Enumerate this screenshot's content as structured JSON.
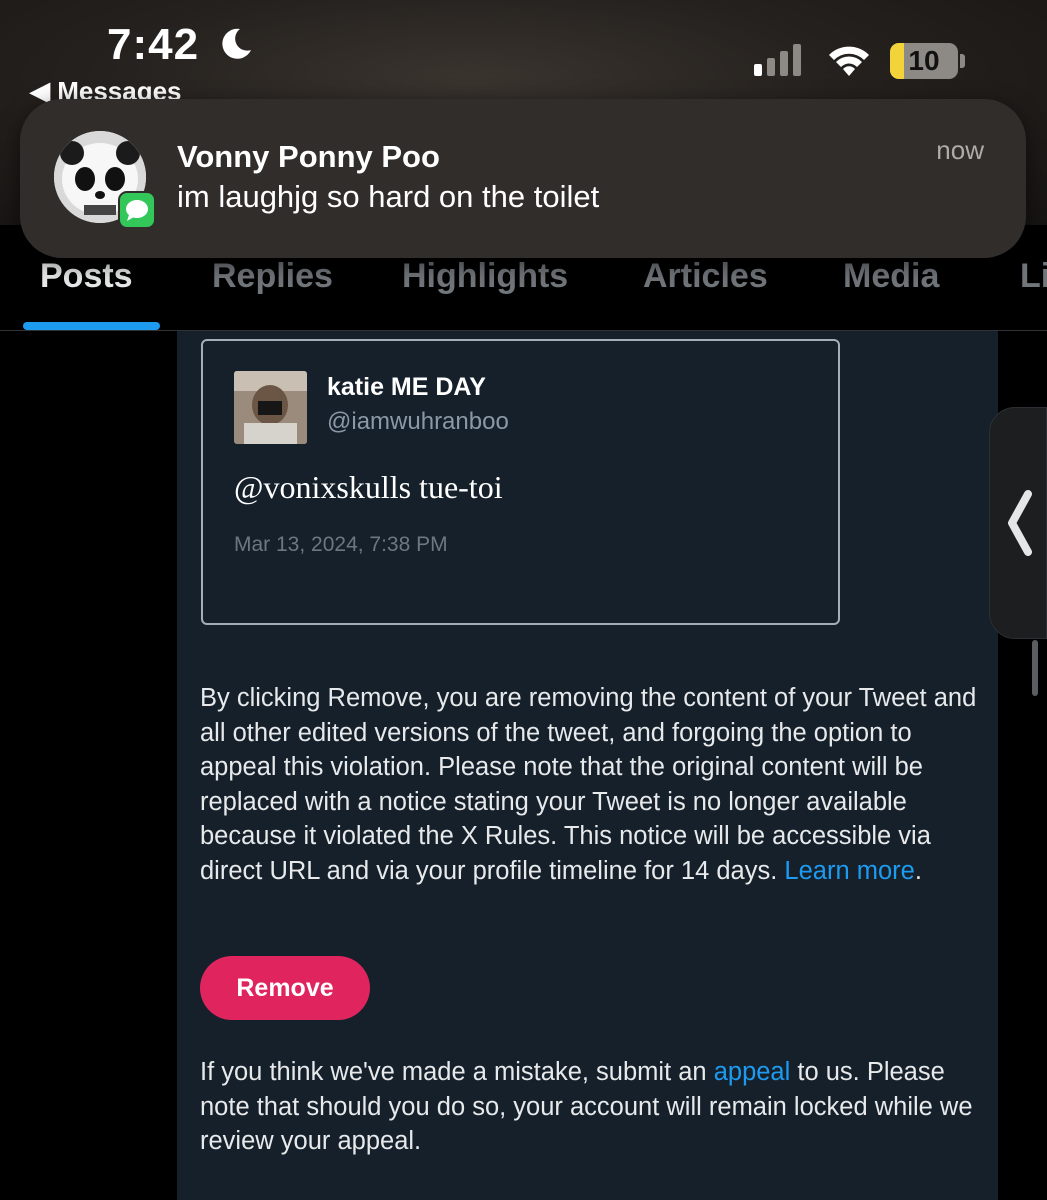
{
  "status_bar": {
    "time": "7:42",
    "back_label": "◀ Messages",
    "battery_level": "10",
    "focus_mode_icon": "moon-icon",
    "signal_bars_active": 1
  },
  "notification": {
    "sender": "Vonny Ponny Poo",
    "message": "im laughjg so hard on the toilet",
    "time": "now",
    "app_icon": "messages-icon"
  },
  "tabs": [
    {
      "label": "Posts",
      "active": true
    },
    {
      "label": "Replies",
      "active": false
    },
    {
      "label": "Highlights",
      "active": false
    },
    {
      "label": "Articles",
      "active": false
    },
    {
      "label": "Media",
      "active": false
    },
    {
      "label": "Li",
      "active": false
    }
  ],
  "quoted_tweet": {
    "display_name": "katie ME DAY",
    "handle": "@iamwuhranboo",
    "text": "@vonixskulls tue-toi",
    "timestamp": "Mar 13, 2024, 7:38 PM"
  },
  "notice": {
    "body": "By clicking Remove, you are removing the content of your Tweet and all other edited versions of the tweet, and forgoing the option to appeal this violation. Please note that the original content will be replaced with a notice stating your Tweet is no longer available because it violated the X Rules. This notice will be accessible via direct URL and via your profile timeline for 14 days.",
    "learn_more": "Learn more",
    "period": ".",
    "remove_button": "Remove",
    "appeal_prefix": "If you think we've made a mistake, submit an",
    "appeal_link": "appeal",
    "appeal_suffix": "to us. Please note that should you do so, your account will remain locked while we review your appeal."
  },
  "colors": {
    "accent": "#1d9bf0",
    "remove": "#e0245e",
    "panel_bg": "#15202b",
    "imessage_green": "#33c759",
    "battery_low": "#f2d33a"
  }
}
